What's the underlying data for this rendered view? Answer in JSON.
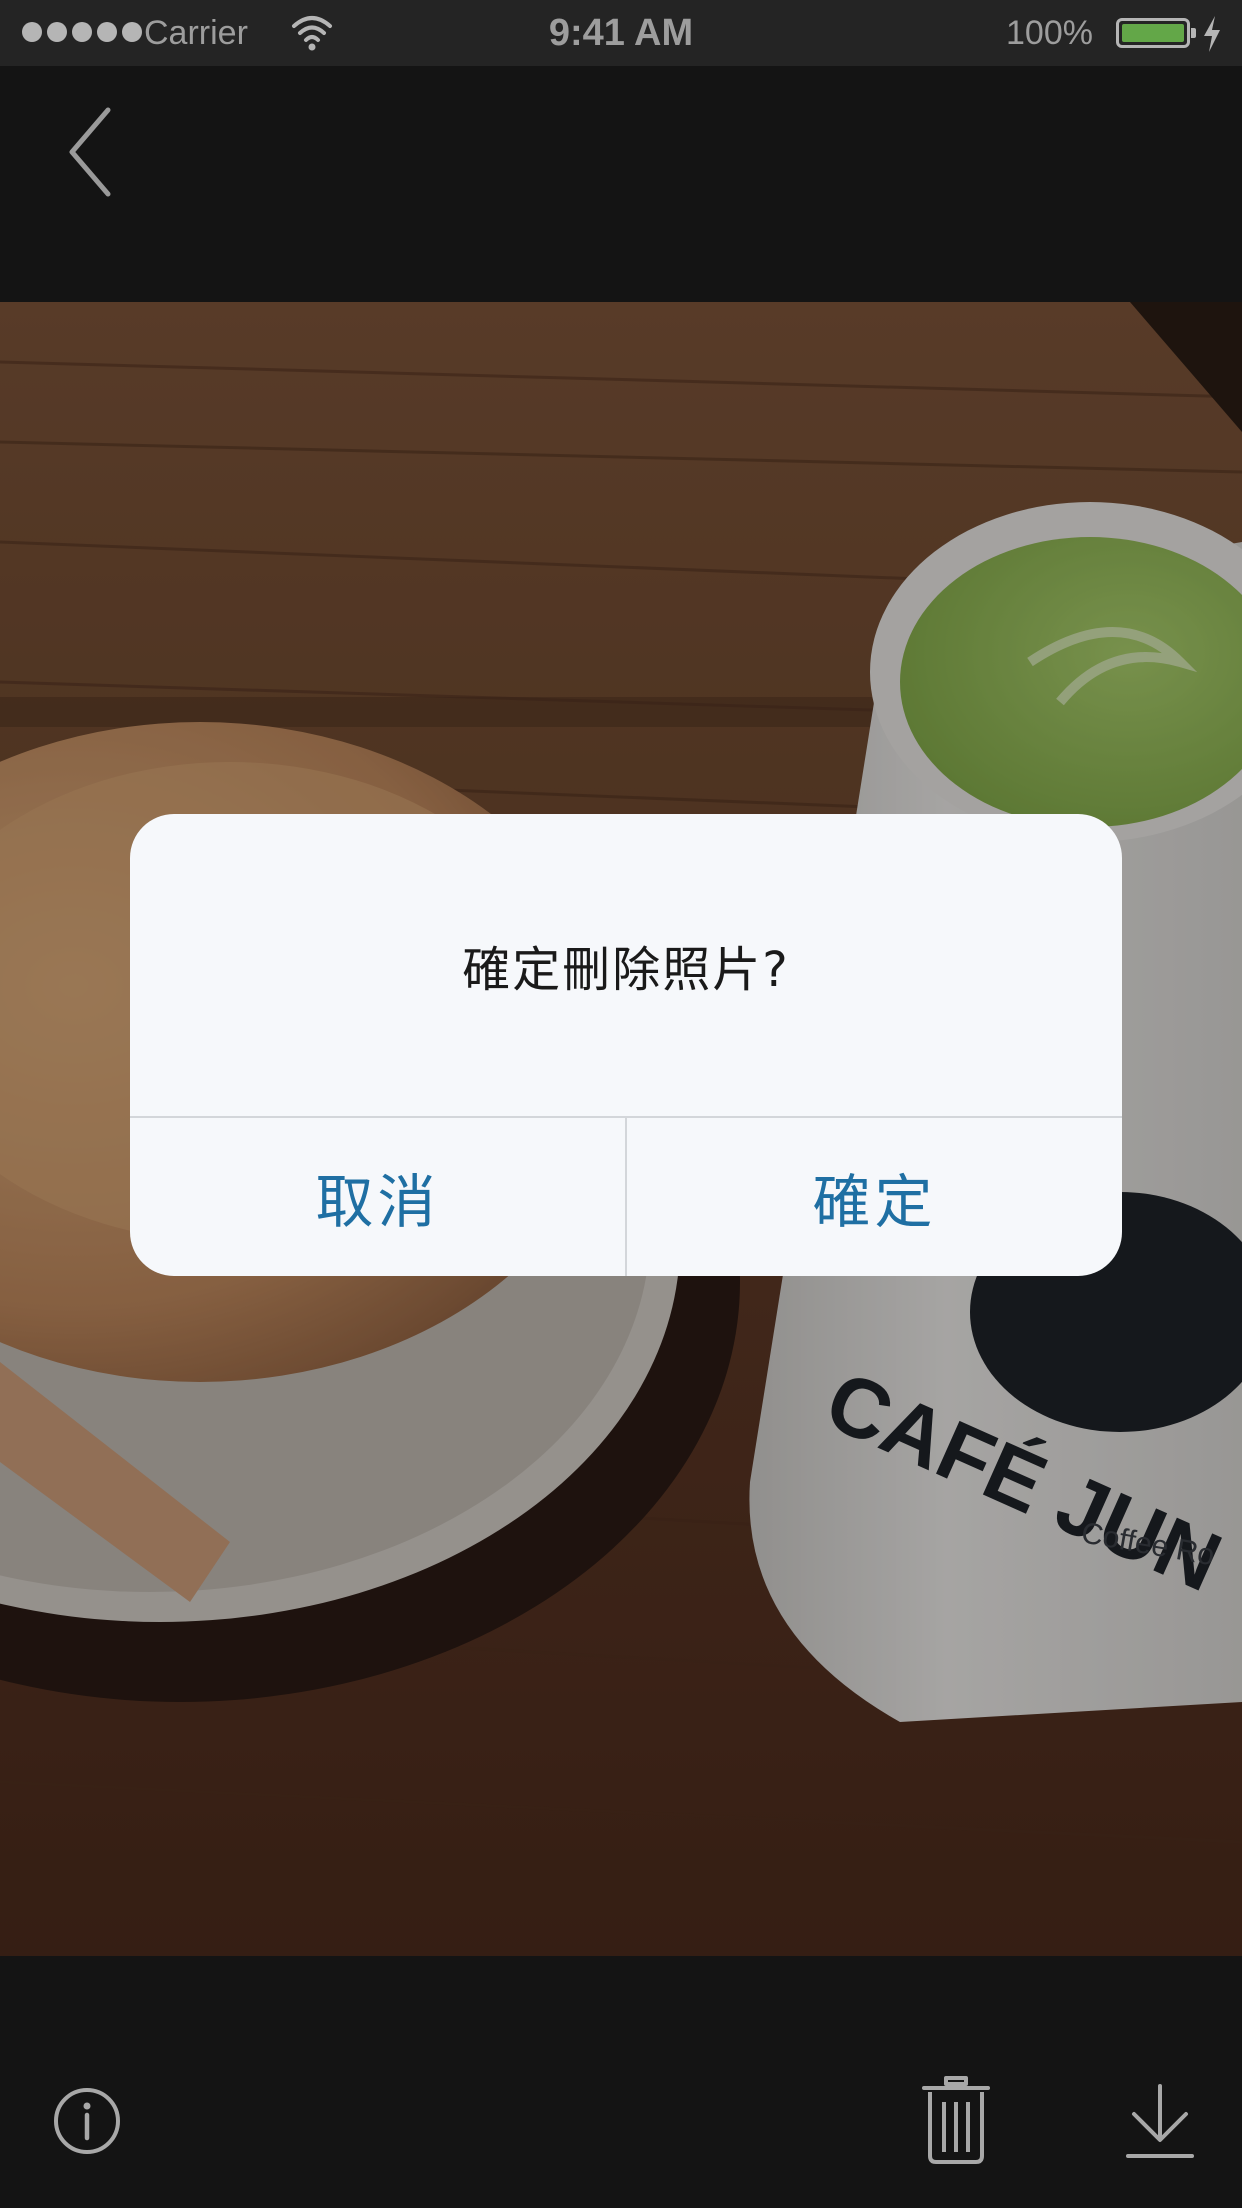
{
  "status_bar": {
    "carrier": "Carrier",
    "time": "9:41 AM",
    "battery_percent": "100%",
    "battery_color": "#63a748",
    "signal_bars": 5,
    "icons": [
      "signal-dots-icon",
      "wifi-icon",
      "battery-icon",
      "charging-bolt-icon"
    ]
  },
  "nav": {
    "back_icon": "chevron-left-icon"
  },
  "photo": {
    "mug_text_line1": "CAFÉ JUN",
    "mug_text_line2": "Coffee Ro"
  },
  "dialog": {
    "message": "確定刪除照片?",
    "cancel_label": "取消",
    "confirm_label": "確定",
    "button_color": "#1f6fa3"
  },
  "toolbar": {
    "info_icon": "info-icon",
    "trash_icon": "trash-icon",
    "download_icon": "download-icon"
  }
}
